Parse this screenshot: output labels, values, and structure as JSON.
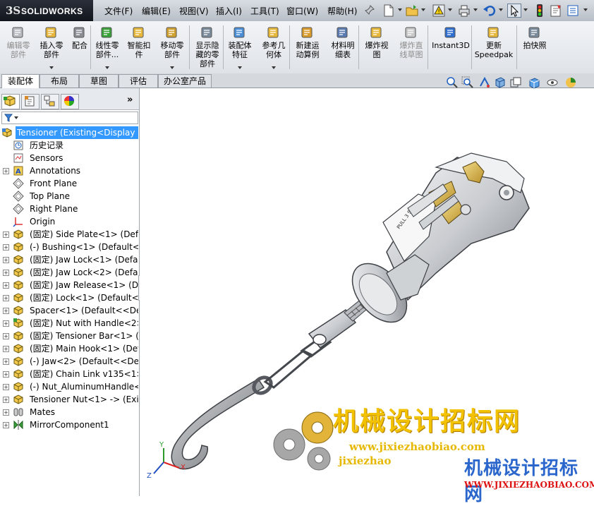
{
  "app": {
    "logo_ds": "3S",
    "logo_text": "SOLIDWORKS"
  },
  "menubar": {
    "items": [
      "文件(F)",
      "编辑(E)",
      "视图(V)",
      "插入(I)",
      "工具(T)",
      "窗口(W)",
      "帮助(H)"
    ]
  },
  "ribbon": {
    "buttons": [
      {
        "label": "编辑零\n部件",
        "icon": "edit-component-icon",
        "disabled": true
      },
      {
        "label": "插入零\n部件",
        "icon": "insert-component-icon",
        "dropdown": true
      },
      {
        "label": "配合",
        "icon": "mate-icon"
      },
      {
        "label": "线性零\n部件...",
        "icon": "linear-pattern-icon",
        "dropdown": true
      },
      {
        "label": "智能扣\n件",
        "icon": "smart-fastener-icon"
      },
      {
        "label": "移动零\n部件",
        "icon": "move-component-icon",
        "dropdown": true
      },
      {
        "label": "显示隐\n藏的零\n部件",
        "icon": "show-hidden-icon"
      },
      {
        "label": "装配体\n特征",
        "icon": "assembly-feature-icon",
        "dropdown": true
      },
      {
        "label": "参考几\n何体",
        "icon": "reference-geometry-icon",
        "dropdown": true
      },
      {
        "label": "新建运\n动算例",
        "icon": "motion-study-icon"
      },
      {
        "label": "材料明\n细表",
        "icon": "bom-icon"
      },
      {
        "label": "爆炸视\n图",
        "icon": "exploded-view-icon"
      },
      {
        "label": "爆炸直\n线草图",
        "icon": "explode-line-sketch-icon",
        "disabled": true
      },
      {
        "label": "Instant3D",
        "icon": "instant3d-icon"
      },
      {
        "label": "更新\nSpeedpak",
        "icon": "speedpak-icon"
      },
      {
        "label": "拍快照",
        "icon": "snapshot-icon"
      }
    ]
  },
  "tabs": [
    "装配体",
    "布局",
    "草图",
    "评估",
    "办公室产品"
  ],
  "tree": {
    "root": "Tensioner  (Existing<Display S",
    "items": [
      {
        "label": "历史记录",
        "icon": "history-icon",
        "expand": false
      },
      {
        "label": "Sensors",
        "icon": "sensors-icon",
        "expand": false
      },
      {
        "label": "Annotations",
        "icon": "annotations-icon",
        "expand": true
      },
      {
        "label": "Front Plane",
        "icon": "plane-icon",
        "expand": false
      },
      {
        "label": "Top Plane",
        "icon": "plane-icon",
        "expand": false
      },
      {
        "label": "Right Plane",
        "icon": "plane-icon",
        "expand": false
      },
      {
        "label": "Origin",
        "icon": "origin-icon",
        "expand": false
      },
      {
        "label": "(固定) Side Plate<1> (Defa",
        "icon": "part-icon",
        "expand": true
      },
      {
        "label": "(-) Bushing<1> (Default<<",
        "icon": "part-icon",
        "expand": true
      },
      {
        "label": "(固定) Jaw Lock<1> (Defau",
        "icon": "part-icon",
        "expand": true
      },
      {
        "label": "(固定) Jaw Lock<2> (Defau",
        "icon": "part-icon",
        "expand": true
      },
      {
        "label": "(固定) Jaw Release<1> (De",
        "icon": "part-icon",
        "expand": true
      },
      {
        "label": "(固定) Lock<1> (Default<<",
        "icon": "part-icon",
        "expand": true
      },
      {
        "label": "Spacer<1> (Default<<Def",
        "icon": "part-icon",
        "expand": true
      },
      {
        "label": "(固定) Nut with Handle<2>",
        "icon": "subassembly-icon",
        "expand": true
      },
      {
        "label": "(固定) Tensioner Bar<1> (I",
        "icon": "part-icon",
        "expand": true
      },
      {
        "label": "(固定) Main Hook<1> (Def",
        "icon": "part-icon",
        "expand": true
      },
      {
        "label": "(-) Jaw<2> (Default<<Defa",
        "icon": "part-icon",
        "expand": true
      },
      {
        "label": "(固定) Chain Link v135<1>",
        "icon": "part-icon",
        "expand": true
      },
      {
        "label": "(-) Nut_AluminumHandle<1",
        "icon": "part-icon",
        "expand": true
      },
      {
        "label": "Tensioner Nut<1> -> (Exis",
        "icon": "part-icon",
        "expand": true
      },
      {
        "label": "Mates",
        "icon": "mates-icon",
        "expand": true
      },
      {
        "label": "MirrorComponent1",
        "icon": "mirror-component-icon",
        "expand": true
      }
    ]
  },
  "triad": {
    "x": "X",
    "y": "Y",
    "z": "Z"
  },
  "watermark": {
    "title": "机械设计招标网",
    "url1": "www.jixiezhaobiao.com",
    "url2": "jixiezhao",
    "title2": "机械设计招标网",
    "url3": "WWW.JIXIEZHAOBIAO.COM"
  },
  "colors": {
    "selection": "#3399ff",
    "watermark_yellow": "#f2c200",
    "watermark_blue": "#2a66cc",
    "watermark_red": "#dd1111"
  }
}
